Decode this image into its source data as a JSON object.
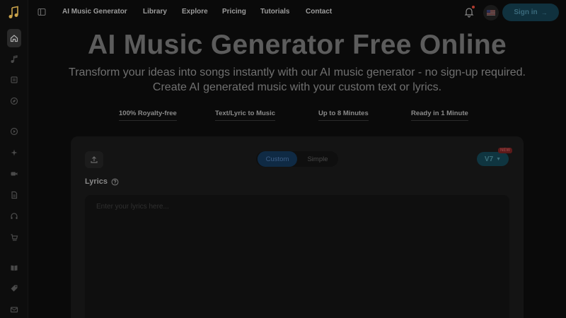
{
  "nav": {
    "links": [
      "AI Music Generator",
      "Library",
      "Explore",
      "Pricing",
      "Tutorials",
      "Contact"
    ],
    "signin_label": "Sign in",
    "flag_icon": "us-flag-icon",
    "has_notification": true
  },
  "sidebar": {
    "icons": [
      "home-icon",
      "music-note-icon",
      "library-icon",
      "compass-icon",
      "circle-play-icon",
      "sparkles-icon",
      "video-icon",
      "document-icon",
      "headphones-icon",
      "cart-icon",
      "book-icon",
      "tag-icon",
      "mail-icon"
    ],
    "active": "home-icon"
  },
  "hero": {
    "title": "AI Music Generator Free Online",
    "subtitle_line1": "Transform your ideas into songs instantly with our AI music generator - no sign-up required.",
    "subtitle_line2": "Create AI generated music with your custom text or lyrics."
  },
  "features": [
    "100% Royalty-free",
    "Text/Lyric to Music",
    "Up to 8 Minutes",
    "Ready in 1 Minute"
  ],
  "card": {
    "mode_options": [
      "Custom",
      "Simple"
    ],
    "selected_mode": "Custom",
    "version_label": "V7",
    "new_badge": "NEW",
    "lyrics_label": "Lyrics",
    "lyrics_placeholder": "Enter your lyrics here..."
  },
  "colors": {
    "accent_blue": "#0f2a44",
    "accent_teal": "#0f3540",
    "badge_red": "#5c1a1a"
  }
}
